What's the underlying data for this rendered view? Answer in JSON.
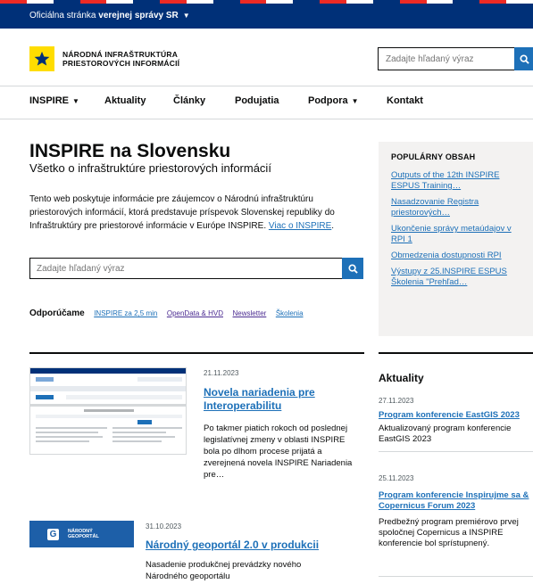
{
  "gov_bar": {
    "prefix": "Oficiálna stránka",
    "bold": "verejnej správy SR",
    "stripe_colors": [
      "#ee2a24",
      "#ffffff",
      "#003078",
      "#ee2a24",
      "#ffffff",
      "#003078",
      "#ee2a24",
      "#ffffff",
      "#003078",
      "#ee2a24",
      "#ffffff",
      "#003078",
      "#ee2a24",
      "#ffffff",
      "#003078",
      "#ee2a24",
      "#ffffff",
      "#003078",
      "#ee2a24",
      "#ffffff"
    ]
  },
  "header": {
    "brand_line1": "NÁRODNÁ INFRAŠTRUKTÚRA",
    "brand_line2": "PRIESTOROVÝCH INFORMÁCIÍ",
    "search_placeholder": "Zadajte hľadaný výraz",
    "search_icon": "search-icon",
    "logo_icon": "star-icon"
  },
  "nav": {
    "items": [
      {
        "label": "INSPIRE",
        "dropdown": true
      },
      {
        "label": "Aktuality",
        "dropdown": false
      },
      {
        "label": "Články",
        "dropdown": false
      },
      {
        "label": "Podujatia",
        "dropdown": false
      },
      {
        "label": "Podpora",
        "dropdown": true
      },
      {
        "label": "Kontakt",
        "dropdown": false
      }
    ]
  },
  "hero": {
    "title": "INSPIRE na Slovensku",
    "subtitle": "Všetko o infraštruktúre priestorových informácií",
    "description": "Tento web poskytuje informácie pre záujemcov o Národnú infraštruktúru priestorových informácií, ktorá predstavuje príspevok Slovenskej republiky do Infraštruktúry pre priestorové informácie v Európe INSPIRE.",
    "more_link": "Viac o INSPIRE",
    "search_placeholder": "Zadajte hľadaný výraz",
    "recommend_label": "Odporúčame",
    "recommend_links": [
      "INSPIRE za 2,5 min",
      "OpenData & HVD",
      "Newsletter",
      "Školenia"
    ]
  },
  "popular": {
    "heading": "POPULÁRNY OBSAH",
    "items": [
      "Outputs of the 12th INSPIRE ESPUS Training…",
      "Nasadzovanie Registra priestorových…",
      "Ukončenie správy metaúdajov v RPI 1",
      "Obmedzenia dostupnosti RPI",
      "Výstupy z 25.INSPIRE ESPUS Školenia \"Prehľad…"
    ]
  },
  "articles": [
    {
      "date": "21.11.2023",
      "title": "Novela nariadenia pre Interoperabilitu",
      "text": "Po takmer piatich rokoch od poslednej legislatívnej zmeny v oblasti INSPIRE bola po dlhom procese prijatá a zverejnená novela INSPIRE Nariadenia pre…"
    },
    {
      "date": "31.10.2023",
      "title": "Národný geoportál 2.0 v produkcii",
      "text": "Nasadenie produkčnej prevádzky nového Národného geoportálu",
      "thumb_line1": "NÁRODNÝ",
      "thumb_line2": "GEOPORTÁL"
    }
  ],
  "news": {
    "heading": "Aktuality",
    "items": [
      {
        "date": "27.11.2023",
        "title": "Program konferencie EastGIS 2023",
        "text": "Aktualizovaný program konferencie EastGIS 2023"
      },
      {
        "date": "25.11.2023",
        "title": "Program konferencie Inspirujme sa & Copernicus Forum 2023",
        "text": "Predbežný program premiérovo prvej spoločnej Copernicus a INSPIRE konferencie bol sprístupnený."
      }
    ]
  },
  "colors": {
    "gov_blue": "#003078",
    "link_blue": "#1d70b8",
    "logo_yellow": "#ffdd00",
    "panel_grey": "#f3f2f1"
  }
}
